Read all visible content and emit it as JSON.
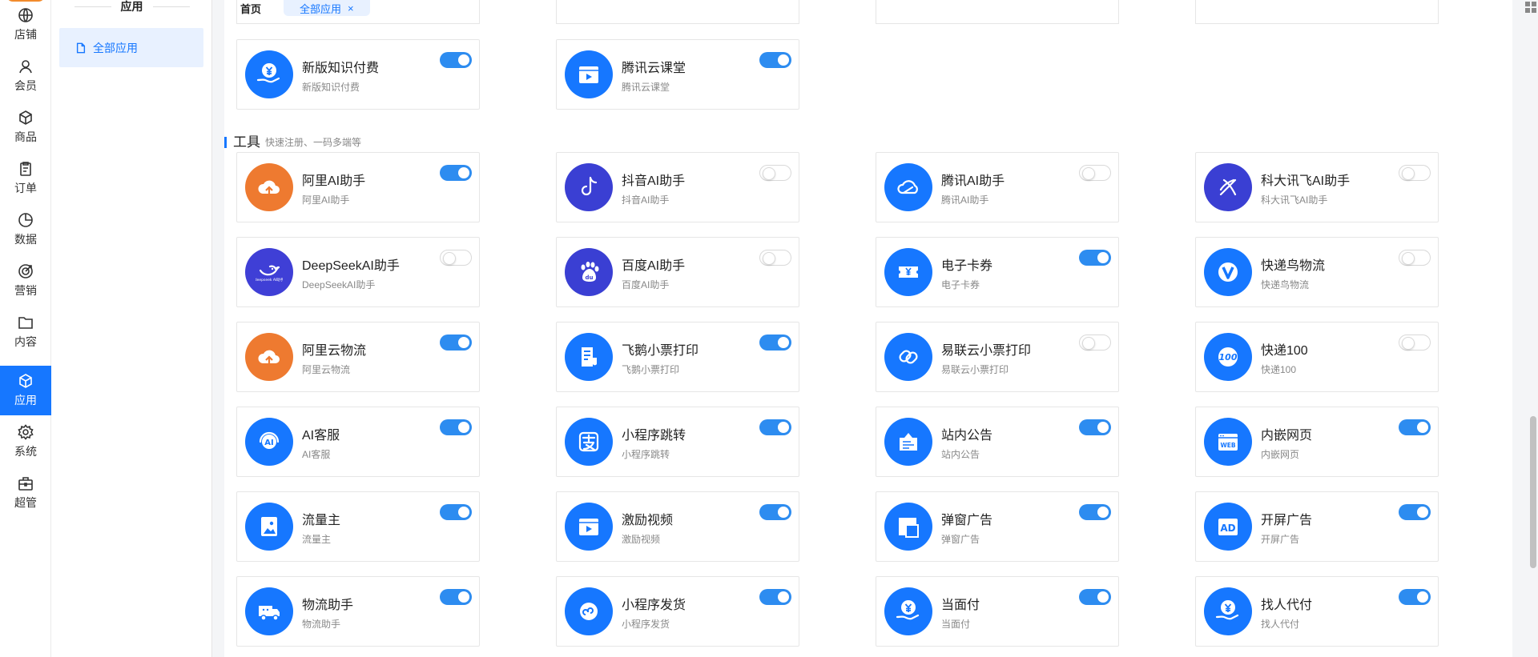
{
  "rail": [
    {
      "label": "店铺",
      "icon": "store-icon"
    },
    {
      "label": "会员",
      "icon": "member-icon"
    },
    {
      "label": "商品",
      "icon": "goods-icon"
    },
    {
      "label": "订单",
      "icon": "order-icon"
    },
    {
      "label": "数据",
      "icon": "data-icon"
    },
    {
      "label": "营销",
      "icon": "marketing-icon"
    },
    {
      "label": "内容",
      "icon": "content-icon"
    },
    {
      "label": "应用",
      "icon": "app-icon",
      "active": true
    },
    {
      "label": "系统",
      "icon": "system-icon"
    },
    {
      "label": "超管",
      "icon": "admin-icon"
    }
  ],
  "submenu": {
    "title": "应用",
    "item": "全部应用"
  },
  "tabs": {
    "home": "首页",
    "active": "全部应用",
    "close": "×"
  },
  "colors": {
    "accent": "#1677ff",
    "toggle_on": "#2d8cf0",
    "orange": "#ee7a30",
    "deepseek": "#3f3fd6"
  },
  "top_cards": [
    {
      "name": "新版知识付费",
      "desc": "新版知识付费",
      "on": true,
      "icon": "yuan-hand-icon",
      "color": "#1677ff"
    },
    {
      "name": "腾讯云课堂",
      "desc": "腾讯云课堂",
      "on": true,
      "icon": "video-icon",
      "color": "#1677ff"
    }
  ],
  "section": {
    "title": "工具",
    "subtitle": "快速注册、一码多端等"
  },
  "tool_cards": [
    {
      "name": "阿里AI助手",
      "desc": "阿里AI助手",
      "on": true,
      "icon": "cloud-upload-icon",
      "color": "#ee7a30"
    },
    {
      "name": "抖音AI助手",
      "desc": "抖音AI助手",
      "on": false,
      "icon": "douyin-icon",
      "color": "#3a3fd3"
    },
    {
      "name": "腾讯AI助手",
      "desc": "腾讯AI助手",
      "on": false,
      "icon": "tencent-cloud-icon",
      "color": "#1677ff"
    },
    {
      "name": "科大讯飞AI助手",
      "desc": "科大讯飞AI助手",
      "on": false,
      "icon": "iflytek-icon",
      "color": "#3a3fd3"
    },
    {
      "name": "DeepSeekAI助手",
      "desc": "DeepSeekAI助手",
      "on": false,
      "icon": "deepseek-icon",
      "color": "#3f3fd6"
    },
    {
      "name": "百度AI助手",
      "desc": "百度AI助手",
      "on": false,
      "icon": "baidu-icon",
      "color": "#3a3fd3"
    },
    {
      "name": "电子卡券",
      "desc": "电子卡券",
      "on": true,
      "icon": "coupon-icon",
      "color": "#1677ff"
    },
    {
      "name": "快递鸟物流",
      "desc": "快递鸟物流",
      "on": false,
      "icon": "kdniao-icon",
      "color": "#1677ff"
    },
    {
      "name": "阿里云物流",
      "desc": "阿里云物流",
      "on": true,
      "icon": "cloud-upload-icon",
      "color": "#ee7a30"
    },
    {
      "name": "飞鹅小票打印",
      "desc": "飞鹅小票打印",
      "on": true,
      "icon": "receipt-icon",
      "color": "#1677ff"
    },
    {
      "name": "易联云小票打印",
      "desc": "易联云小票打印",
      "on": false,
      "icon": "link-icon",
      "color": "#1677ff"
    },
    {
      "name": "快递100",
      "desc": "快递100",
      "on": false,
      "icon": "kuaidi100-icon",
      "color": "#1677ff"
    },
    {
      "name": "AI客服",
      "desc": "AI客服",
      "on": true,
      "icon": "ai-service-icon",
      "color": "#1677ff"
    },
    {
      "name": "小程序跳转",
      "desc": "小程序跳转",
      "on": true,
      "icon": "alipay-icon",
      "color": "#1677ff"
    },
    {
      "name": "站内公告",
      "desc": "站内公告",
      "on": true,
      "icon": "notice-icon",
      "color": "#1677ff"
    },
    {
      "name": "内嵌网页",
      "desc": "内嵌网页",
      "on": true,
      "icon": "web-icon",
      "color": "#1677ff"
    },
    {
      "name": "流量主",
      "desc": "流量主",
      "on": true,
      "icon": "picture-icon",
      "color": "#1677ff"
    },
    {
      "name": "激励视频",
      "desc": "激励视频",
      "on": true,
      "icon": "video-icon",
      "color": "#1677ff"
    },
    {
      "name": "弹窗广告",
      "desc": "弹窗广告",
      "on": true,
      "icon": "popup-icon",
      "color": "#1677ff"
    },
    {
      "name": "开屏广告",
      "desc": "开屏广告",
      "on": true,
      "icon": "ad-icon",
      "color": "#1677ff"
    },
    {
      "name": "物流助手",
      "desc": "物流助手",
      "on": true,
      "icon": "truck-icon",
      "color": "#1677ff"
    },
    {
      "name": "小程序发货",
      "desc": "小程序发货",
      "on": true,
      "icon": "miniprogram-icon",
      "color": "#1677ff"
    },
    {
      "name": "当面付",
      "desc": "当面付",
      "on": true,
      "icon": "yuan-hand-icon",
      "color": "#1677ff"
    },
    {
      "name": "找人代付",
      "desc": "找人代付",
      "on": true,
      "icon": "yuan-hand-icon",
      "color": "#1677ff"
    }
  ]
}
